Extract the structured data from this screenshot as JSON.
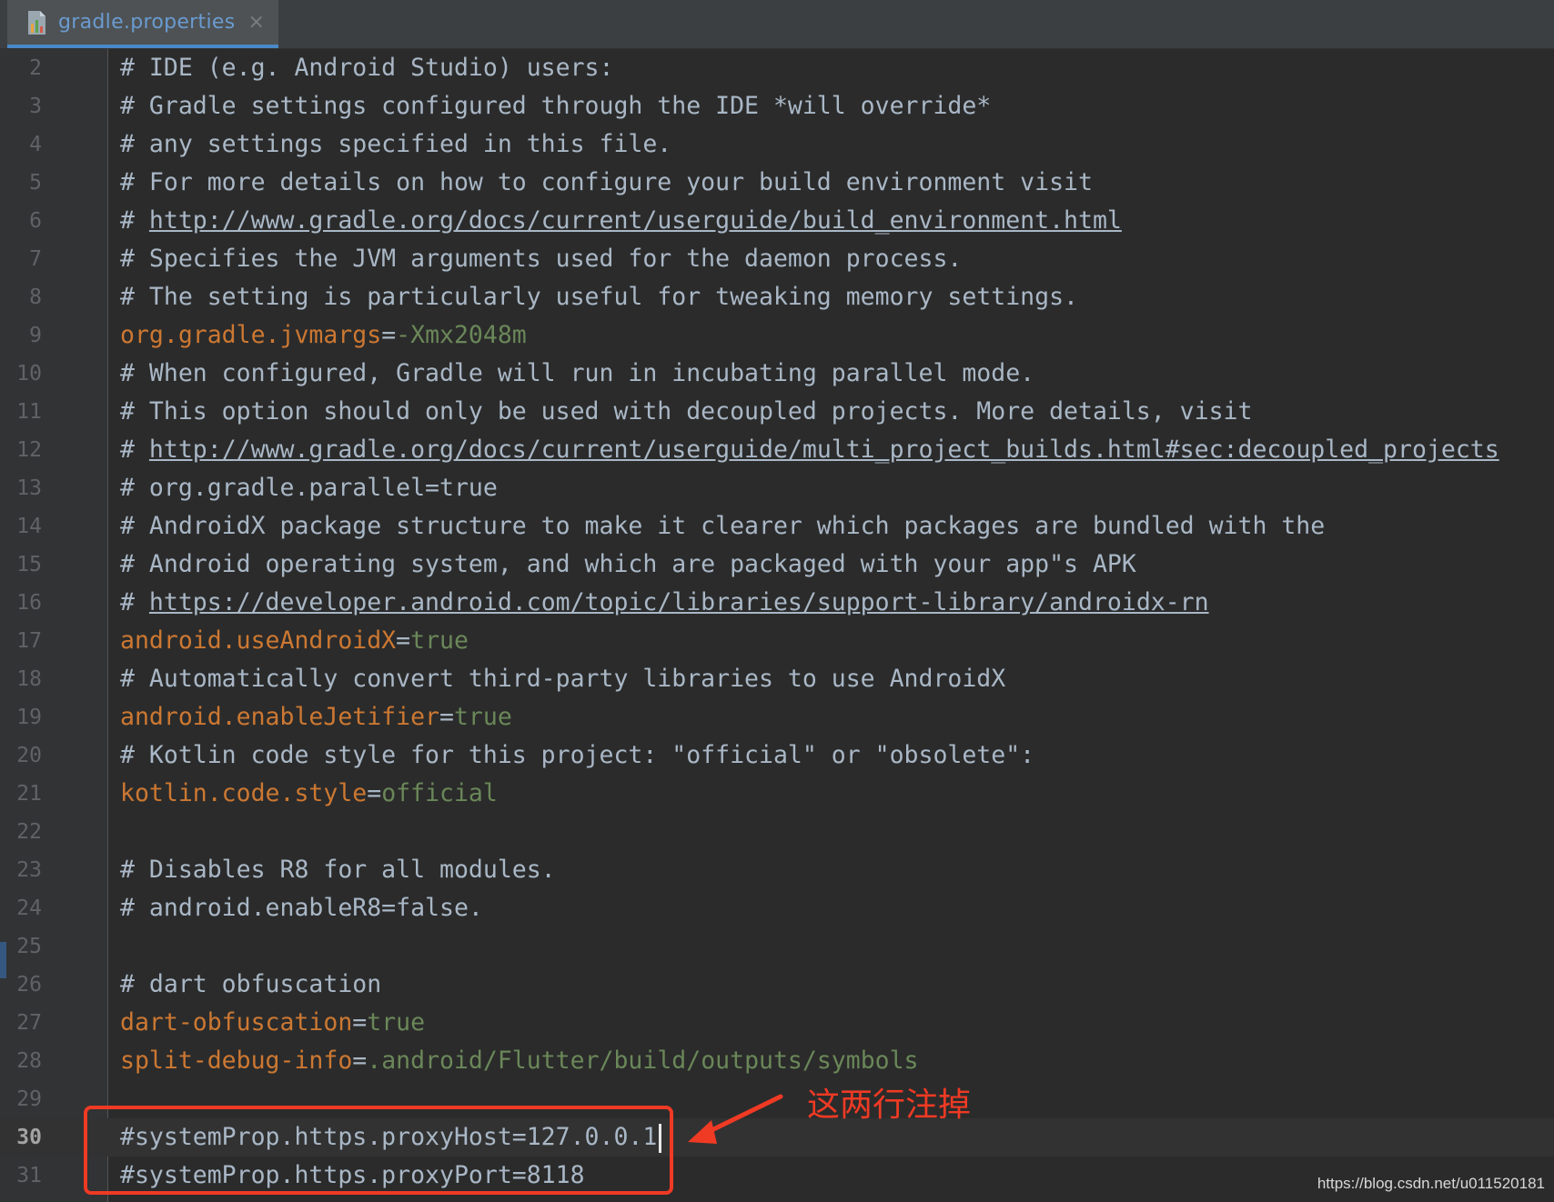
{
  "tab": {
    "title": "gradle.properties",
    "close_glyph": "×",
    "icon": "properties-file-icon"
  },
  "lines": [
    {
      "num": "2",
      "parts": [
        {
          "t": "c",
          "v": "# IDE (e.g. Android Studio) users:"
        }
      ]
    },
    {
      "num": "3",
      "parts": [
        {
          "t": "c",
          "v": "# Gradle settings configured through the IDE *will override*"
        }
      ]
    },
    {
      "num": "4",
      "parts": [
        {
          "t": "c",
          "v": "# any settings specified in this file."
        }
      ]
    },
    {
      "num": "5",
      "parts": [
        {
          "t": "c",
          "v": "# For more details on how to configure your build environment visit"
        }
      ]
    },
    {
      "num": "6",
      "parts": [
        {
          "t": "c",
          "v": "# "
        },
        {
          "t": "l",
          "v": "http://www.gradle.org/docs/current/userguide/build_environment.html"
        }
      ]
    },
    {
      "num": "7",
      "parts": [
        {
          "t": "c",
          "v": "# Specifies the JVM arguments used for the daemon process."
        }
      ]
    },
    {
      "num": "8",
      "parts": [
        {
          "t": "c",
          "v": "# The setting is particularly useful for tweaking memory settings."
        }
      ]
    },
    {
      "num": "9",
      "parts": [
        {
          "t": "k",
          "v": "org.gradle.jvmargs"
        },
        {
          "t": "e",
          "v": "="
        },
        {
          "t": "v",
          "v": "-Xmx2048m"
        }
      ]
    },
    {
      "num": "10",
      "parts": [
        {
          "t": "c",
          "v": "# When configured, Gradle will run in incubating parallel mode."
        }
      ]
    },
    {
      "num": "11",
      "parts": [
        {
          "t": "c",
          "v": "# This option should only be used with decoupled projects. More details, visit"
        }
      ]
    },
    {
      "num": "12",
      "parts": [
        {
          "t": "c",
          "v": "# "
        },
        {
          "t": "l",
          "v": "http://www.gradle.org/docs/current/userguide/multi_project_builds.html#sec:decoupled_projects"
        }
      ]
    },
    {
      "num": "13",
      "parts": [
        {
          "t": "c",
          "v": "# org.gradle.parallel=true"
        }
      ]
    },
    {
      "num": "14",
      "parts": [
        {
          "t": "c",
          "v": "# AndroidX package structure to make it clearer which packages are bundled with the"
        }
      ]
    },
    {
      "num": "15",
      "parts": [
        {
          "t": "c",
          "v": "# Android operating system, and which are packaged with your app\"s APK"
        }
      ]
    },
    {
      "num": "16",
      "parts": [
        {
          "t": "c",
          "v": "# "
        },
        {
          "t": "l",
          "v": "https://developer.android.com/topic/libraries/support-library/androidx-rn"
        }
      ]
    },
    {
      "num": "17",
      "parts": [
        {
          "t": "k",
          "v": "android.useAndroidX"
        },
        {
          "t": "e",
          "v": "="
        },
        {
          "t": "v",
          "v": "true"
        }
      ]
    },
    {
      "num": "18",
      "parts": [
        {
          "t": "c",
          "v": "# Automatically convert third-party libraries to use AndroidX"
        }
      ]
    },
    {
      "num": "19",
      "parts": [
        {
          "t": "k",
          "v": "android.enableJetifier"
        },
        {
          "t": "e",
          "v": "="
        },
        {
          "t": "v",
          "v": "true"
        }
      ]
    },
    {
      "num": "20",
      "parts": [
        {
          "t": "c",
          "v": "# Kotlin code style for this project: \"official\" or \"obsolete\":"
        }
      ]
    },
    {
      "num": "21",
      "parts": [
        {
          "t": "k",
          "v": "kotlin.code.style"
        },
        {
          "t": "e",
          "v": "="
        },
        {
          "t": "v",
          "v": "official"
        }
      ]
    },
    {
      "num": "22",
      "parts": []
    },
    {
      "num": "23",
      "parts": [
        {
          "t": "c",
          "v": "# Disables R8 for all modules."
        }
      ]
    },
    {
      "num": "24",
      "parts": [
        {
          "t": "c",
          "v": "# android.enableR8=false."
        }
      ]
    },
    {
      "num": "25",
      "parts": []
    },
    {
      "num": "26",
      "parts": [
        {
          "t": "c",
          "v": "# dart obfuscation"
        }
      ]
    },
    {
      "num": "27",
      "parts": [
        {
          "t": "k",
          "v": "dart-obfuscation"
        },
        {
          "t": "e",
          "v": "="
        },
        {
          "t": "v",
          "v": "true"
        }
      ]
    },
    {
      "num": "28",
      "parts": [
        {
          "t": "k",
          "v": "split-debug-info"
        },
        {
          "t": "e",
          "v": "="
        },
        {
          "t": "v",
          "v": ".android/Flutter/build/outputs/symbols"
        }
      ]
    },
    {
      "num": "29",
      "parts": []
    },
    {
      "num": "30",
      "parts": [
        {
          "t": "p",
          "v": "#systemProp.https.proxyHost=127.0.0.1"
        }
      ],
      "current": true,
      "caret": true
    },
    {
      "num": "31",
      "parts": [
        {
          "t": "p",
          "v": "#systemProp.https.proxyPort=8118"
        }
      ]
    }
  ],
  "annotation": {
    "text": "这两行注掉",
    "color": "#ef3a24"
  },
  "watermark": "https://blog.csdn.net/u011520181"
}
